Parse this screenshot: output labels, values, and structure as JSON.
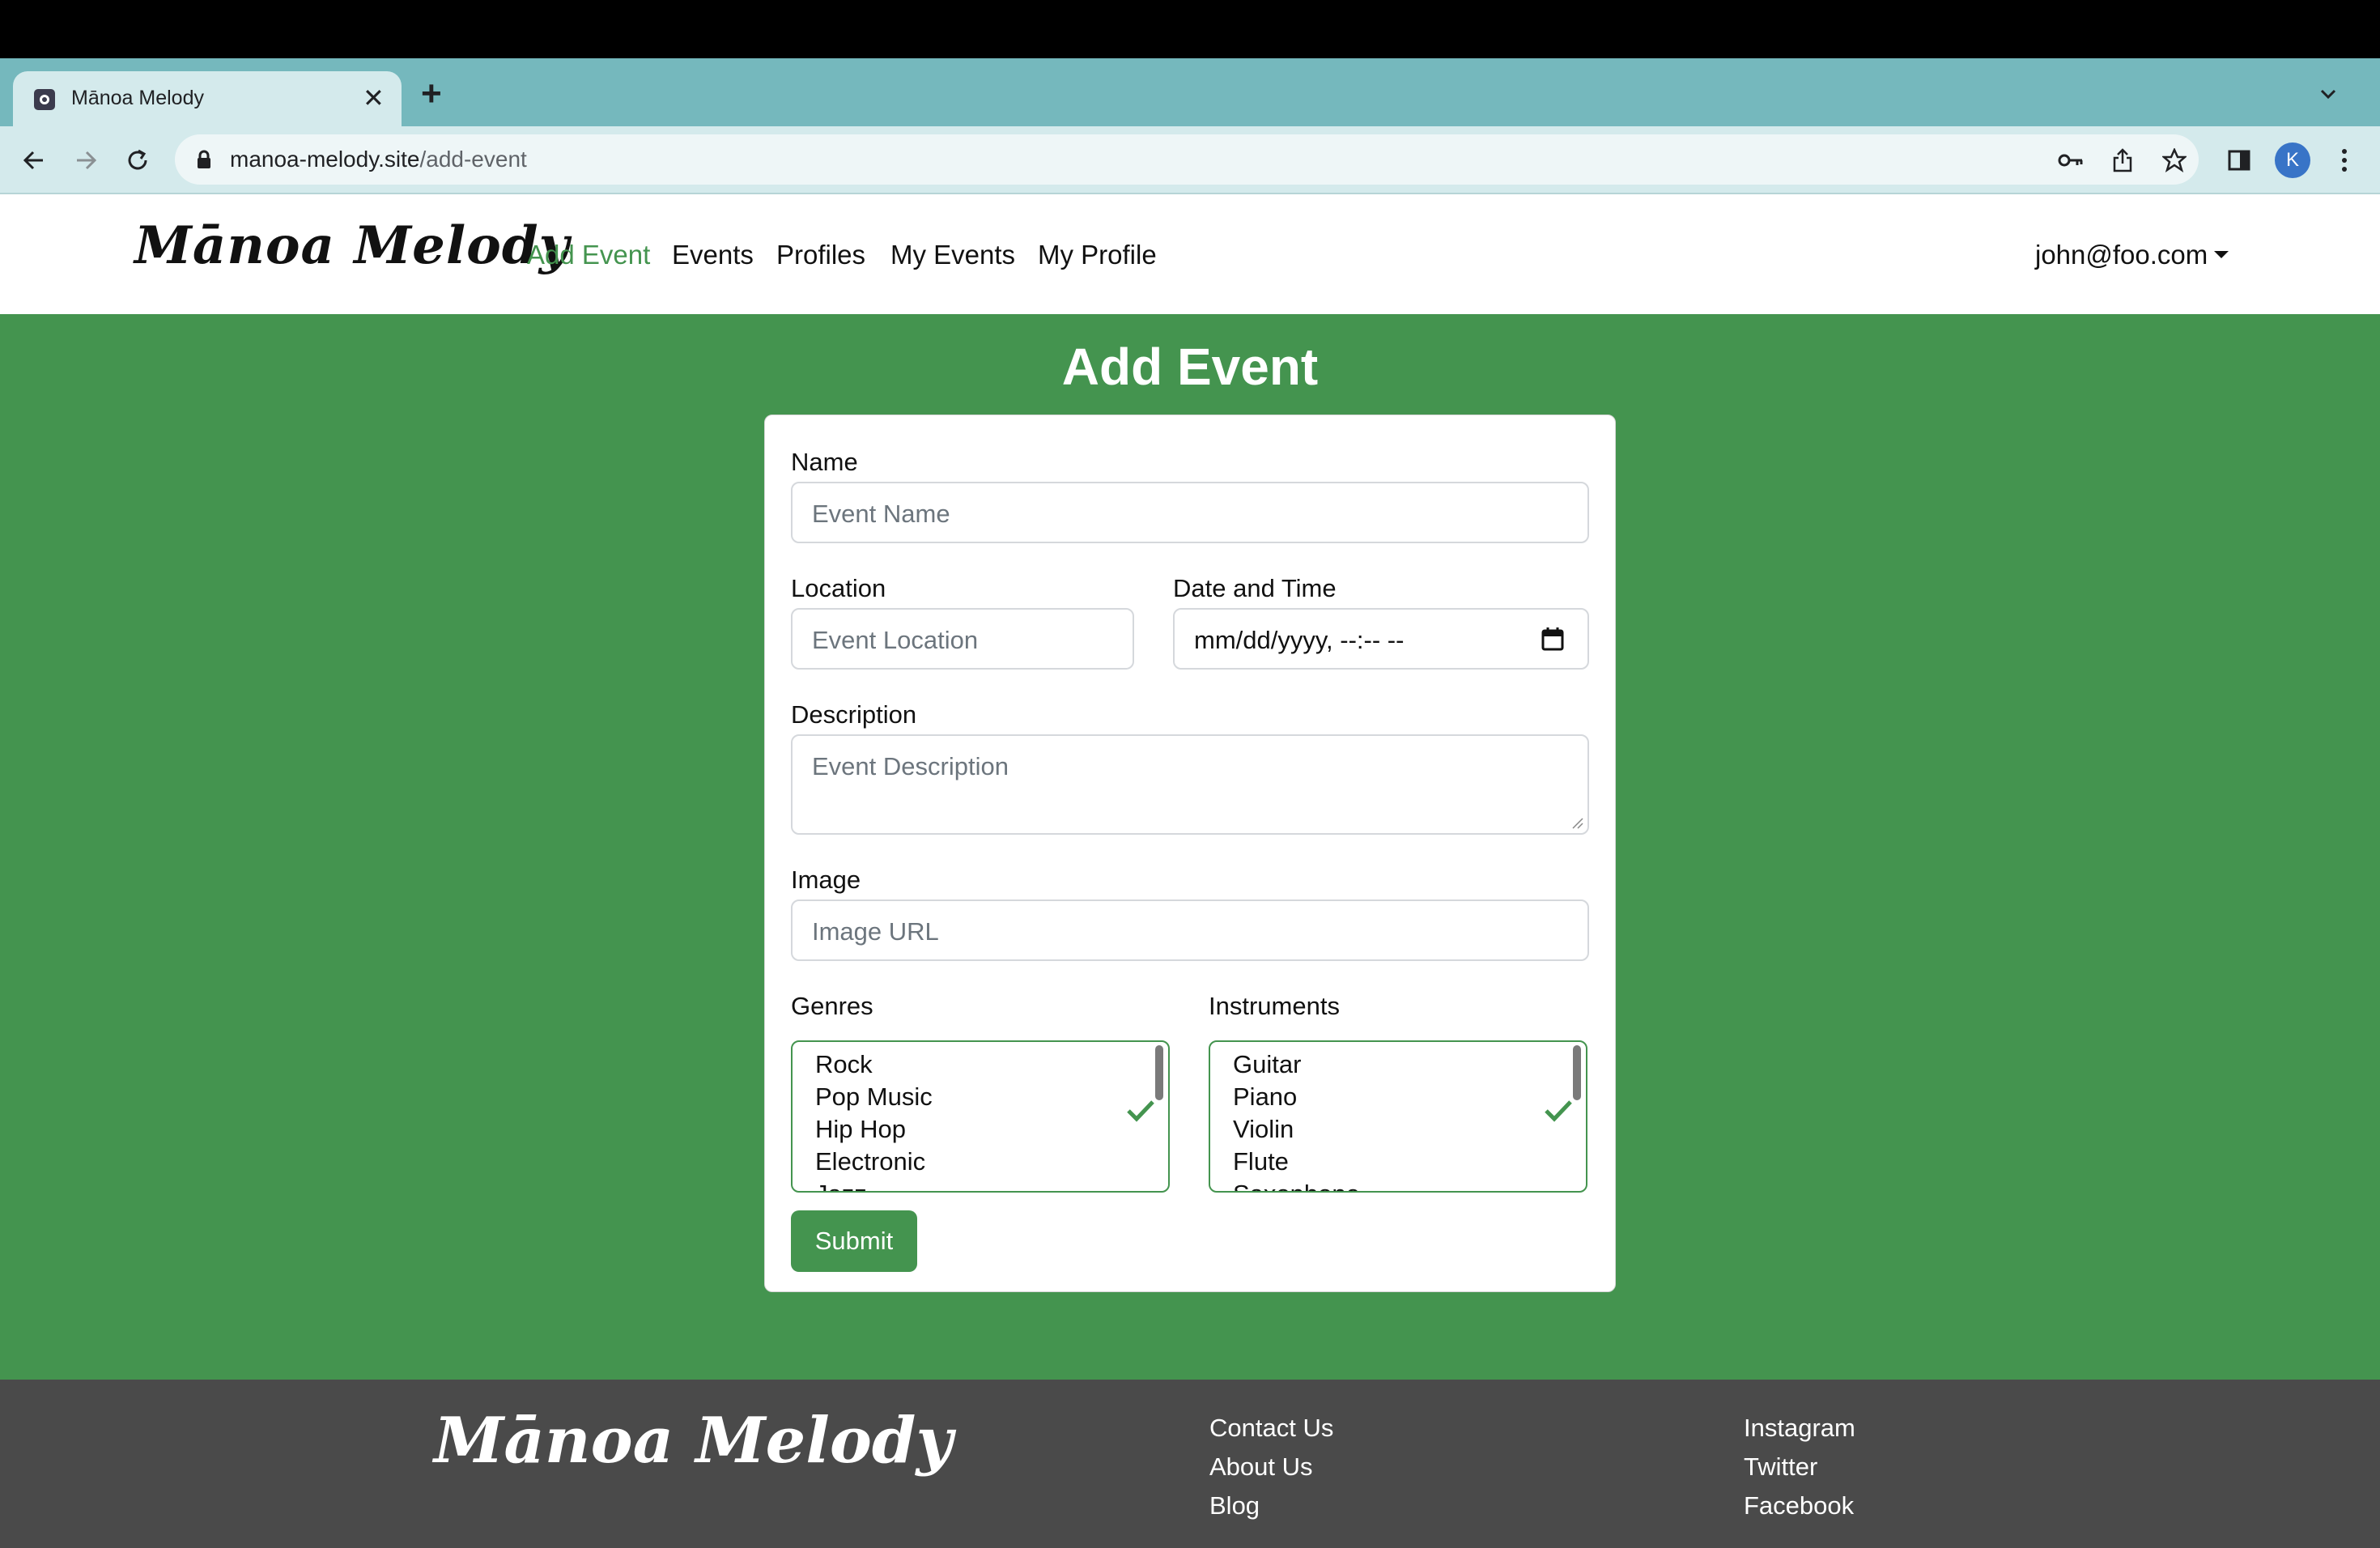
{
  "browser": {
    "tab_title": "Mānoa Melody",
    "new_tab_symbol": "+",
    "close_symbol": "✕",
    "url_host": "manoa-melody.site",
    "url_path": "/add-event",
    "avatar_letter": "K"
  },
  "navbar": {
    "brand": "Mānoa Melody",
    "links": [
      "Add Event",
      "Events",
      "Profiles",
      "My Events",
      "My Profile"
    ],
    "active_link": "Add Event",
    "user_email": "john@foo.com"
  },
  "form": {
    "title": "Add Event",
    "name": {
      "label": "Name",
      "placeholder": "Event Name"
    },
    "location": {
      "label": "Location",
      "placeholder": "Event Location"
    },
    "datetime": {
      "label": "Date and Time",
      "value": "mm/dd/yyyy, --:-- --"
    },
    "description": {
      "label": "Description",
      "placeholder": "Event Description"
    },
    "image": {
      "label": "Image",
      "placeholder": "Image URL"
    },
    "genres": {
      "label": "Genres",
      "options": [
        "Rock",
        "Pop Music",
        "Hip Hop",
        "Electronic",
        "Jazz"
      ]
    },
    "instruments": {
      "label": "Instruments",
      "options": [
        "Guitar",
        "Piano",
        "Violin",
        "Flute",
        "Saxophone"
      ]
    },
    "submit_label": "Submit"
  },
  "footer": {
    "brand": "Mānoa Melody",
    "col1": [
      "Contact Us",
      "About Us",
      "Blog"
    ],
    "col2": [
      "Instagram",
      "Twitter",
      "Facebook"
    ]
  },
  "colors": {
    "page_green": "#44944f",
    "tab_strip": "#75b8bd",
    "footer_gray": "#4a4a4a"
  }
}
